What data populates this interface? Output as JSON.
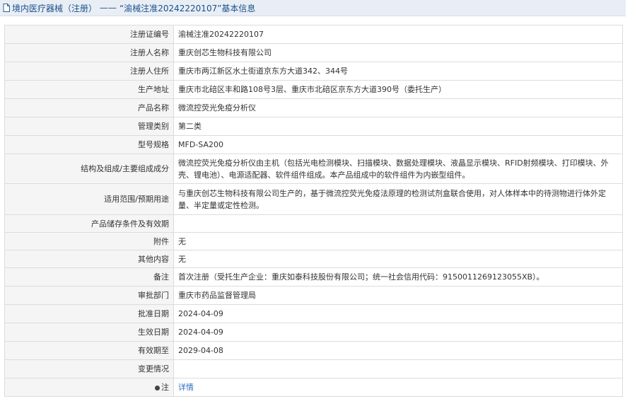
{
  "header": {
    "category": "境内医疗器械（注册）",
    "separator": "——",
    "record_title": "“渝械注准20242220107”基本信息"
  },
  "rows": [
    {
      "label": "注册证编号",
      "value": "渝械注准20242220107"
    },
    {
      "label": "注册人名称",
      "value": "重庆创芯生物科技有限公司"
    },
    {
      "label": "注册人住所",
      "value": "重庆市两江新区水土街道京东方大道342、344号"
    },
    {
      "label": "生产地址",
      "value": "重庆市北碚区丰和路108号3层、重庆市北碚区京东方大道390号（委托生产）"
    },
    {
      "label": "产品名称",
      "value": "微流控荧光免疫分析仪"
    },
    {
      "label": "管理类别",
      "value": "第二类"
    },
    {
      "label": "型号规格",
      "value": "MFD-SA200"
    },
    {
      "label": "结构及组成/主要组成成分",
      "value": "微流控荧光免疫分析仪由主机（包括光电检测模块、扫描模块、数据处理模块、液晶显示模块、RFID射频模块、打印模块、外壳、锂电池）、电源适配器、软件组件组成。本产品组成中的软件组件为内嵌型组件。"
    },
    {
      "label": "适用范围/预期用途",
      "value": "与重庆创芯生物科技有限公司生产的，基于微流控荧光免疫法原理的检测试剂盒联合使用，对人体样本中的待测物进行体外定量、半定量或定性检测。"
    },
    {
      "label": "产品储存条件及有效期",
      "value": ""
    },
    {
      "label": "附件",
      "value": "无"
    },
    {
      "label": "其他内容",
      "value": "无"
    },
    {
      "label": "备注",
      "value": "首次注册（受托生产企业：重庆如泰科技股份有限公司；统一社会信用代码：9150011269123055XB）。"
    },
    {
      "label": "审批部门",
      "value": "重庆市药品监督管理局"
    },
    {
      "label": "批准日期",
      "value": "2024-04-09"
    },
    {
      "label": "生效日期",
      "value": "2024-04-09"
    },
    {
      "label": "有效期至",
      "value": "2029-04-08"
    },
    {
      "label": "变更情况",
      "value": ""
    },
    {
      "label": "注",
      "value": "详情"
    }
  ],
  "icons": {
    "header": "document-icon",
    "note": "pin-icon"
  },
  "colors": {
    "link": "#2f6fbf",
    "header_text": "#1a4f8c",
    "label_bg": "#f5f5f5"
  }
}
